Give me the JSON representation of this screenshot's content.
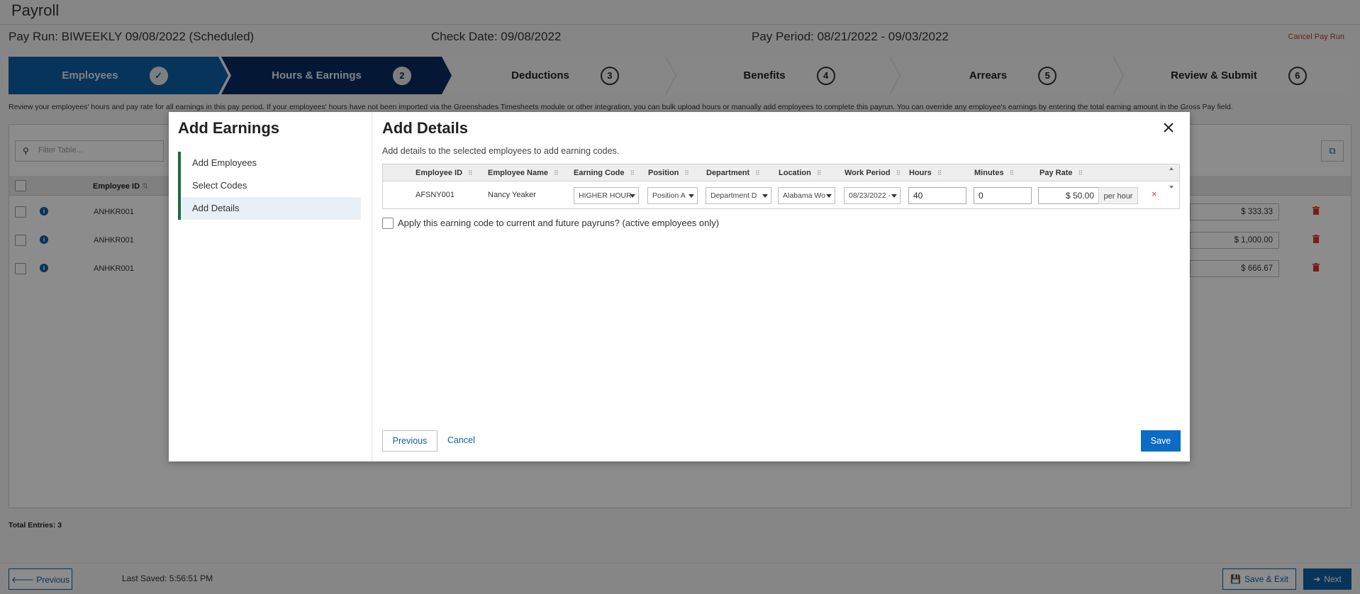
{
  "app": {
    "title": "Payroll"
  },
  "payrun": {
    "label": "Pay Run: BIWEEKLY 09/08/2022 (Scheduled)",
    "check_date": "Check Date: 09/08/2022",
    "pay_period": "Pay Period: 08/21/2022 - 09/03/2022",
    "cancel": "Cancel Pay Run"
  },
  "steps": [
    {
      "label": "Employees",
      "num": "✓",
      "state": "done"
    },
    {
      "label": "Hours & Earnings",
      "num": "2",
      "state": "active"
    },
    {
      "label": "Deductions",
      "num": "3",
      "state": "pending"
    },
    {
      "label": "Benefits",
      "num": "4",
      "state": "pending"
    },
    {
      "label": "Arrears",
      "num": "5",
      "state": "pending"
    },
    {
      "label": "Review & Submit",
      "num": "6",
      "state": "pending"
    }
  ],
  "help_text": "Review your employees' hours and pay rate for all earnings in this pay period. If your employees' hours have not been imported via the Greenshades Timesheets module or other integration, you can bulk upload hours or manually add employees to complete this payrun. You can override any employee's earnings by entering the total earning amount in the Gross Pay field.",
  "grid": {
    "filter_placeholder": "Filter Table...",
    "col_employee_id": "Employee ID",
    "rows": [
      {
        "employee_id": "ANHKR001",
        "gross": "$ 333.33"
      },
      {
        "employee_id": "ANHKR001",
        "gross": "$ 1,000.00"
      },
      {
        "employee_id": "ANHKR001",
        "gross": "$ 666.67"
      }
    ],
    "total_entries": "Total Entries: 3"
  },
  "footer": {
    "previous": "🡐 Previous",
    "last_saved": "Last Saved: 5:56:51 PM",
    "save_exit": "Save & Exit",
    "next": "Next"
  },
  "modal": {
    "side_title": "Add Earnings",
    "side_items": [
      "Add Employees",
      "Select Codes",
      "Add Details"
    ],
    "title": "Add Details",
    "subtitle": "Add details to the selected employees to add earning codes.",
    "columns": [
      "Employee ID",
      "Employee Name",
      "Earning Code",
      "Position",
      "Department",
      "Location",
      "Work Period",
      "Hours",
      "Minutes",
      "Pay Rate"
    ],
    "row": {
      "employee_id": "AFSNY001",
      "employee_name": "Nancy Yeaker",
      "earning_code": "HIGHER HOUR",
      "position": "Position A",
      "department": "Department D",
      "location": "Alabama Wo",
      "work_period": "08/23/2022 -",
      "hours": "40",
      "minutes": "0",
      "pay_rate": "$ 50.00",
      "rate_unit": "per hour",
      "remove": "×"
    },
    "apply_label": "Apply this earning code to current and future payruns? (active employees only)",
    "previous": "Previous",
    "cancel": "Cancel",
    "save": "Save"
  },
  "colors": {
    "step_done": "#0d5fa6",
    "step_active": "#082d63",
    "primary": "#0b6cc4",
    "accent_bar": "#1d6b3d",
    "danger": "#d9352c"
  }
}
